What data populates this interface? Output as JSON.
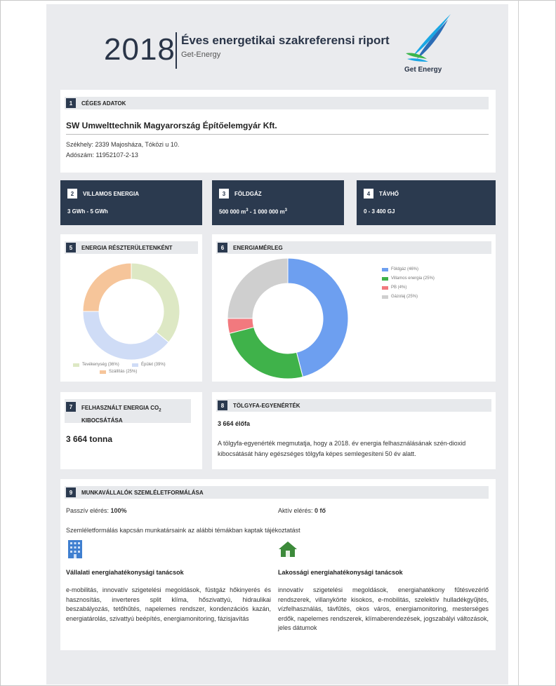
{
  "header": {
    "year": "2018",
    "title": "Éves energetikai szakreferensi riport",
    "subtitle": "Get-Energy",
    "logo_text": "Get Energy"
  },
  "s1": {
    "num": "1",
    "title": "CÉGES ADATOK",
    "company": "SW Umwelttechnik Magyarország Építőelemgyár Kft.",
    "address": "Székhely: 2339 Majosháza, Tóközi u 10.",
    "tax": "Adószám: 11952107-2-13"
  },
  "s2": {
    "num": "2",
    "title": "VILLAMOS ENERGIA",
    "value": "3 GWh - 5 GWh"
  },
  "s3": {
    "num": "3",
    "title": "FÖLDGÁZ",
    "value_a": "500 000 m",
    "value_b": " - 1 000 000 m",
    "sup": "3"
  },
  "s4": {
    "num": "4",
    "title": "TÁVHŐ",
    "value": "0 - 3 400 GJ"
  },
  "s5": {
    "num": "5",
    "title": "ENERGIA RÉSZTERÜLETENKÉNT"
  },
  "s6": {
    "num": "6",
    "title": "ENERGIAMÉRLEG"
  },
  "s7": {
    "num": "7",
    "title_a": "FELHASZNÁLT ENERGIA CO",
    "title_sub": "2",
    "title_b": "KIBOCSÁTÁSA",
    "value": "3 664 tonna"
  },
  "s8": {
    "num": "8",
    "title": "TÖLGYFA-EGYENÉRTÉK",
    "value": "3 664 élőfa",
    "text": "A tölgyfa-egyenérték megmutatja, hogy a 2018. év energia felhasználásának szén-dioxid kibocsátását hány egészséges tölgyfa képes semlegesíteni 50 év alatt."
  },
  "s9": {
    "num": "9",
    "title": "MUNKAVÁLLALÓK SZEMLÉLETFORMÁLÁSA",
    "passive_label": "Passzív elérés: ",
    "passive_value": "100%",
    "active_label": "Aktív elérés: ",
    "active_value": "0 fő",
    "intro": "Szemléletformálás kapcsán munkatársaink az alábbi témákban kaptak tájékoztatást",
    "col1_title": "Vállalati energiahatékonysági tanácsok",
    "col1_text": "e-mobilitás, innovatív szigetelési megoldások, füstgáz hőkinyerés és hasznosítás, inverteres split klíma, hőszivattyú, hidraulikai beszabályozás, tetőhűtés, napelemes rendszer, kondenzációs kazán, energiatárolás, szivattyú beépítés, energiamonitoring, fázisjavítás",
    "col2_title": "Lakossági energiahatékonysági tanácsok",
    "col2_text": "innovatív szigetelési megoldások, energiahatékony fűtésvezérlő rendszerek, villanykörte kisokos, e-mobilitás, szelektív hulladékgyűjtés, vízfelhasználás, távfűtés, okos város, energiamonitoring, mesterséges erdők, napelemes rendszerek, klímaberendezések, jogszabályi változások, jeles dátumok"
  },
  "chart_data": [
    {
      "type": "pie",
      "categories": [
        "Tevékenység",
        "Épület",
        "Szállítás"
      ],
      "values": [
        36,
        39,
        25
      ],
      "colors": [
        "#dde8c4",
        "#cfdcf6",
        "#f6c59a"
      ],
      "legend": [
        "Tevékenység (36%)",
        "Épület (39%)",
        "Szállítás (25%)"
      ],
      "legend_position": "bottom"
    },
    {
      "type": "pie",
      "categories": [
        "Földgáz",
        "Villamos energia",
        "PB",
        "Gázolaj"
      ],
      "values": [
        46,
        25,
        4,
        25
      ],
      "colors": [
        "#6d9ff0",
        "#3fb24a",
        "#f2797e",
        "#cfcfcf"
      ],
      "legend": [
        "Földgáz (46%)",
        "Villamos energia (25%)",
        "PB (4%)",
        "Gázolaj (25%)"
      ],
      "legend_position": "right"
    }
  ]
}
